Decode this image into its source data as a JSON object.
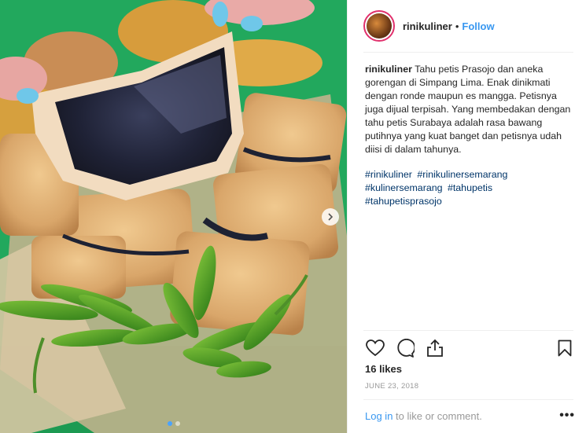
{
  "post": {
    "username": "rinikuliner",
    "separator": "•",
    "follow_label": "Follow",
    "caption_author": "rinikuliner",
    "caption_text": "Tahu petis Prasojo dan aneka gorengan di Simpang Lima. Enak dinikmati dengan ronde maupun es mangga. Petisnya juga dijual terpisah. Yang membedakan dengan tahu petis Surabaya adalah rasa bawang putihnya yang kuat banget dan petisnya udah diisi di dalam tahunya.",
    "hashtags": [
      "#rinikuliner",
      "#rinikulinersemarang",
      "#kulinersemarang",
      "#tahupetis",
      "#tahupetisprasojo"
    ],
    "likes": "16 likes",
    "date": "JUNE 23, 2018",
    "login_link": "Log in",
    "login_rest": " to like or comment.",
    "more_label": "•••"
  },
  "icons": [
    "heart-icon",
    "comment-icon",
    "share-icon",
    "bookmark-icon",
    "chevron-right-icon"
  ],
  "colors": {
    "accent": "#3897f0",
    "hashtag": "#003569",
    "muted": "#999999",
    "photo_background": "#1fa35a"
  },
  "carousel": {
    "slides": 2,
    "active": 1
  }
}
